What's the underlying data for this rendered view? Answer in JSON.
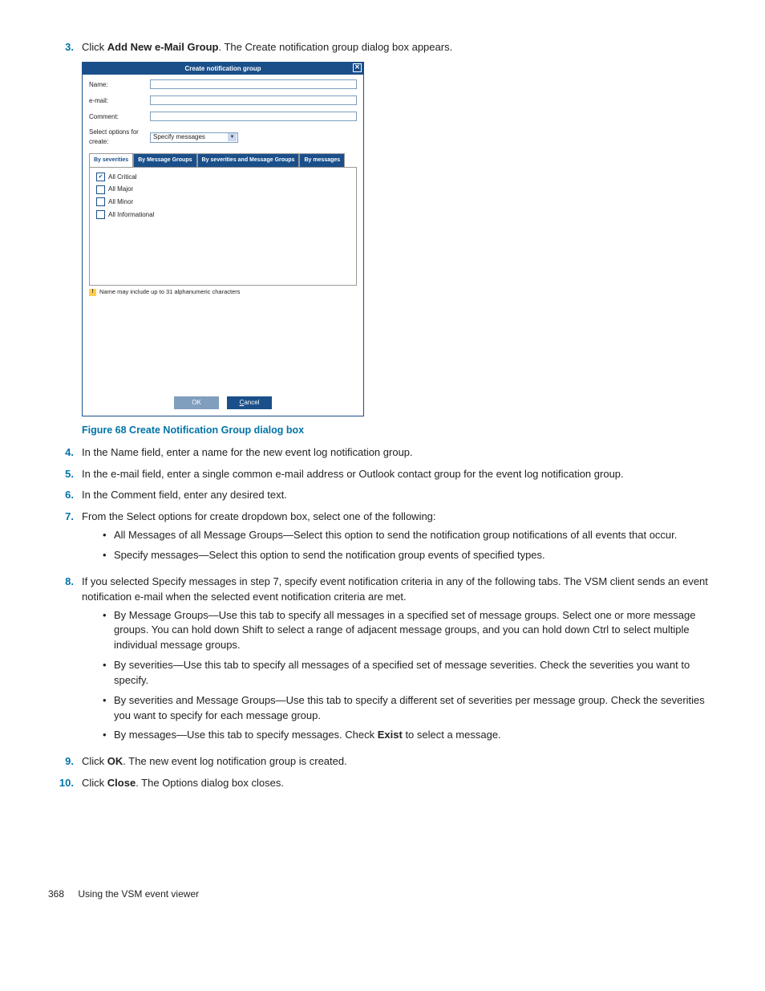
{
  "steps": {
    "s3": {
      "num": "3.",
      "text_a": "Click ",
      "bold": "Add New e-Mail Group",
      "text_b": ". The Create notification group dialog box appears."
    },
    "s4": {
      "num": "4.",
      "text": "In the Name field, enter a name for the new event log notification group."
    },
    "s5": {
      "num": "5.",
      "text": "In the e-mail field, enter a single common e-mail address or Outlook contact group for the event log notification group."
    },
    "s6": {
      "num": "6.",
      "text": "In the Comment field, enter any desired text."
    },
    "s7": {
      "num": "7.",
      "text": "From the Select options for create dropdown box, select one of the following:",
      "bullets": [
        "All Messages of all Message Groups—Select this option to send the notification group notifications of all events that occur.",
        "Specify messages—Select this option to send the notification group events of specified types."
      ]
    },
    "s8": {
      "num": "8.",
      "text": "If you selected Specify messages in step 7, specify event notification criteria in any of the following tabs. The VSM client sends an event notification e-mail when the selected event notification criteria are met.",
      "bullets": [
        "By Message Groups—Use this tab to specify all messages in a specified set of message groups. Select one or more message groups. You can hold down Shift to select a range of adjacent message groups, and you can hold down Ctrl to select multiple individual message groups.",
        "By severities—Use this tab to specify all messages of a specified set of message severities. Check the severities you want to specify.",
        "By severities and Message Groups—Use this tab to specify a different set of severities per message group. Check the severities you want to specify for each message group."
      ],
      "bullet_exist": {
        "pre": "By messages—Use this tab to specify messages. Check ",
        "bold": "Exist",
        "post": " to select a message."
      }
    },
    "s9": {
      "num": "9.",
      "text_a": "Click ",
      "bold": "OK",
      "text_b": ". The new event log notification group is created."
    },
    "s10": {
      "num": "10.",
      "text_a": "Click ",
      "bold": "Close",
      "text_b": ". The Options dialog box closes."
    }
  },
  "figure_caption": "Figure 68 Create Notification Group dialog box",
  "dialog": {
    "title": "Create notification group",
    "labels": {
      "name": "Name:",
      "email": "e-mail:",
      "comment": "Comment:",
      "select": "Select options for create:"
    },
    "select_value": "Specify messages",
    "tabs": [
      "By severities",
      "By Message Groups",
      "By severities and Message Groups",
      "By messages"
    ],
    "checks": [
      {
        "label": "All Critical",
        "checked": true
      },
      {
        "label": "All Major",
        "checked": false
      },
      {
        "label": "All Minor",
        "checked": false
      },
      {
        "label": "All Informational",
        "checked": false
      }
    ],
    "hint": "Name may include up to 31 alphanumeric characters",
    "buttons": {
      "ok": "OK",
      "cancel": "Cancel"
    }
  },
  "footer": {
    "page": "368",
    "section": "Using the VSM event viewer"
  }
}
